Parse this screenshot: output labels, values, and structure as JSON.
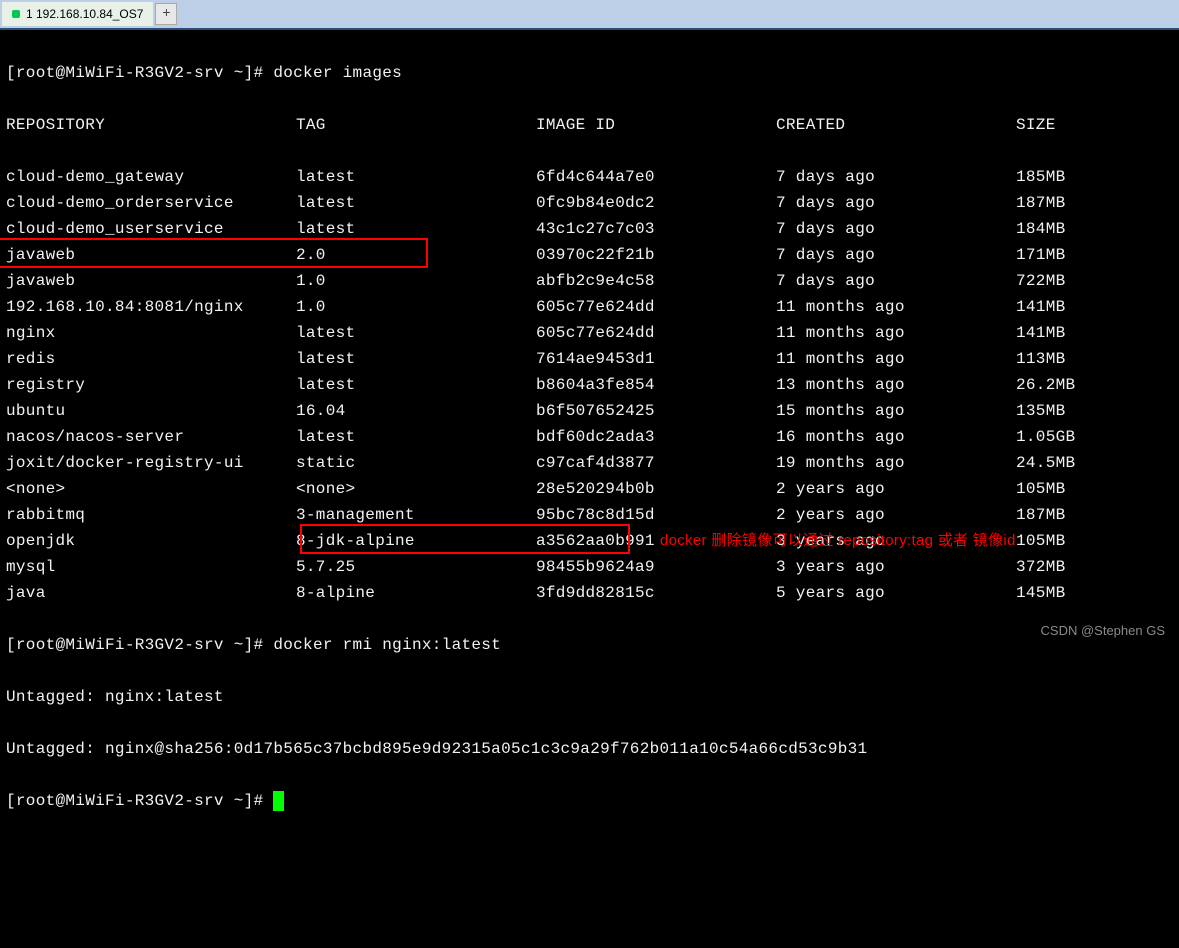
{
  "tab": {
    "title": "1 192.168.10.84_OS7"
  },
  "prompt": "[root@MiWiFi-R3GV2-srv ~]# ",
  "cmd1": "docker images",
  "headers": {
    "repo": "REPOSITORY",
    "tag": "TAG",
    "id": "IMAGE ID",
    "created": "CREATED",
    "size": "SIZE"
  },
  "images": [
    {
      "repo": "cloud-demo_gateway",
      "tag": "latest",
      "id": "6fd4c644a7e0",
      "created": "7 days ago",
      "size": "185MB"
    },
    {
      "repo": "cloud-demo_orderservice",
      "tag": "latest",
      "id": "0fc9b84e0dc2",
      "created": "7 days ago",
      "size": "187MB"
    },
    {
      "repo": "cloud-demo_userservice",
      "tag": "latest",
      "id": "43c1c27c7c03",
      "created": "7 days ago",
      "size": "184MB"
    },
    {
      "repo": "javaweb",
      "tag": "2.0",
      "id": "03970c22f21b",
      "created": "7 days ago",
      "size": "171MB"
    },
    {
      "repo": "javaweb",
      "tag": "1.0",
      "id": "abfb2c9e4c58",
      "created": "7 days ago",
      "size": "722MB"
    },
    {
      "repo": "192.168.10.84:8081/nginx",
      "tag": "1.0",
      "id": "605c77e624dd",
      "created": "11 months ago",
      "size": "141MB"
    },
    {
      "repo": "nginx",
      "tag": "latest",
      "id": "605c77e624dd",
      "created": "11 months ago",
      "size": "141MB"
    },
    {
      "repo": "redis",
      "tag": "latest",
      "id": "7614ae9453d1",
      "created": "11 months ago",
      "size": "113MB"
    },
    {
      "repo": "registry",
      "tag": "latest",
      "id": "b8604a3fe854",
      "created": "13 months ago",
      "size": "26.2MB"
    },
    {
      "repo": "ubuntu",
      "tag": "16.04",
      "id": "b6f507652425",
      "created": "15 months ago",
      "size": "135MB"
    },
    {
      "repo": "nacos/nacos-server",
      "tag": "latest",
      "id": "bdf60dc2ada3",
      "created": "16 months ago",
      "size": "1.05GB"
    },
    {
      "repo": "joxit/docker-registry-ui",
      "tag": "static",
      "id": "c97caf4d3877",
      "created": "19 months ago",
      "size": "24.5MB"
    },
    {
      "repo": "<none>",
      "tag": "<none>",
      "id": "28e520294b0b",
      "created": "2 years ago",
      "size": "105MB"
    },
    {
      "repo": "rabbitmq",
      "tag": "3-management",
      "id": "95bc78c8d15d",
      "created": "2 years ago",
      "size": "187MB"
    },
    {
      "repo": "openjdk",
      "tag": "8-jdk-alpine",
      "id": "a3562aa0b991",
      "created": "3 years ago",
      "size": "105MB"
    },
    {
      "repo": "mysql",
      "tag": "5.7.25",
      "id": "98455b9624a9",
      "created": "3 years ago",
      "size": "372MB"
    },
    {
      "repo": "java",
      "tag": "8-alpine",
      "id": "3fd9dd82815c",
      "created": "5 years ago",
      "size": "145MB"
    }
  ],
  "cmd2": "docker rmi nginx:latest",
  "out1": "Untagged: nginx:latest",
  "out2": "Untagged: nginx@sha256:0d17b565c37bcbd895e9d92315a05c1c3c9a29f762b011a10c54a66cd53c9b31",
  "annotation": "docker 删除镜像可以通过 repository:tag 或者 镜像id",
  "watermark": "CSDN @Stephen GS"
}
